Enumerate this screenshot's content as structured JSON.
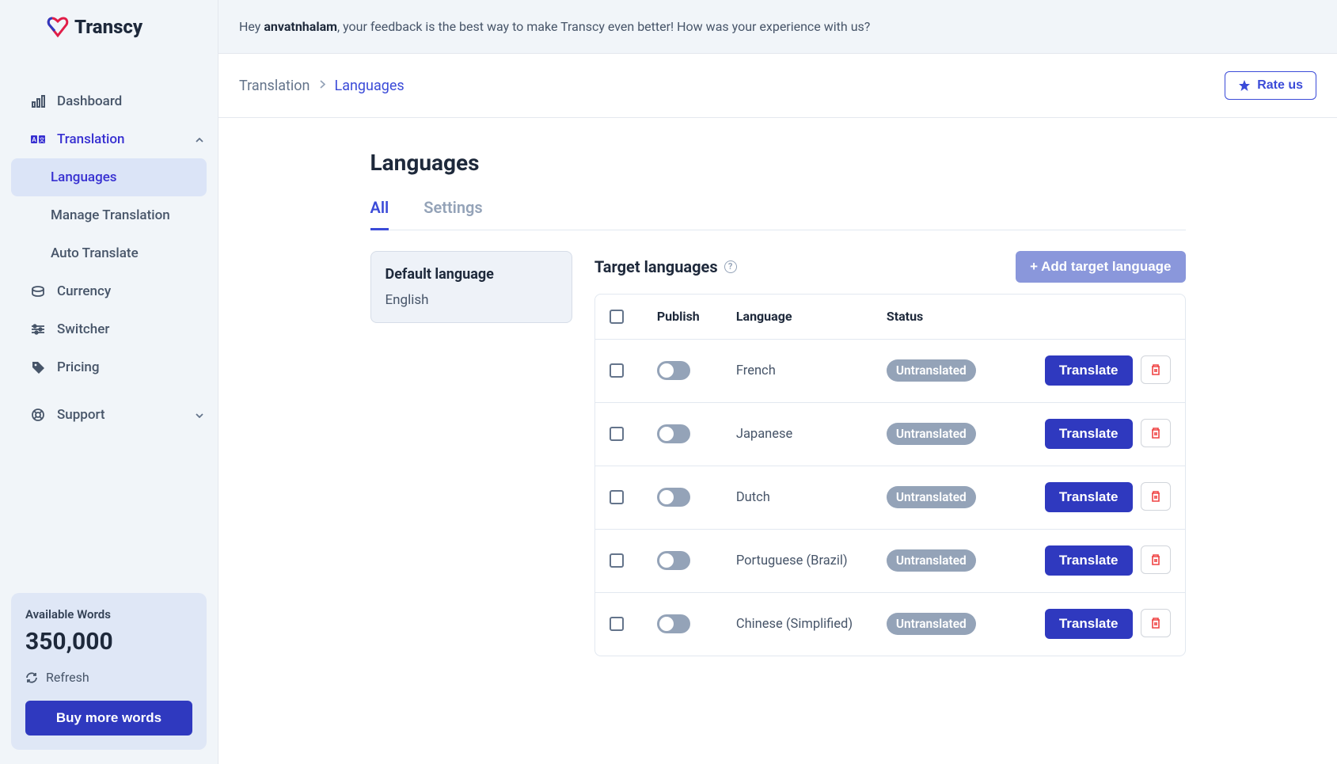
{
  "brand": {
    "name": "Transcy"
  },
  "banner": {
    "prefix": "Hey ",
    "username": "anvatnhalam",
    "suffix": ", your feedback is the best way to make Transcy even better! How was your experience with us?"
  },
  "sidebar": {
    "items": {
      "dashboard": "Dashboard",
      "translation": "Translation",
      "languages": "Languages",
      "manage": "Manage Translation",
      "auto": "Auto Translate",
      "currency": "Currency",
      "switcher": "Switcher",
      "pricing": "Pricing",
      "support": "Support"
    },
    "footer": {
      "label": "Available Words",
      "count": "350,000",
      "refresh": "Refresh",
      "buy": "Buy more words"
    }
  },
  "breadcrumb": {
    "parent": "Translation",
    "current": "Languages"
  },
  "rate_btn": "Rate us",
  "page": {
    "title": "Languages",
    "tab_all": "All",
    "tab_settings": "Settings",
    "default_card": {
      "title": "Default language",
      "value": "English"
    },
    "target_title": "Target languages",
    "add_btn": "+ Add target language",
    "table": {
      "head": {
        "publish": "Publish",
        "language": "Language",
        "status": "Status"
      },
      "translate_btn": "Translate",
      "rows": [
        {
          "language": "French",
          "status": "Untranslated"
        },
        {
          "language": "Japanese",
          "status": "Untranslated"
        },
        {
          "language": "Dutch",
          "status": "Untranslated"
        },
        {
          "language": "Portuguese (Brazil)",
          "status": "Untranslated"
        },
        {
          "language": "Chinese (Simplified)",
          "status": "Untranslated"
        }
      ]
    }
  }
}
